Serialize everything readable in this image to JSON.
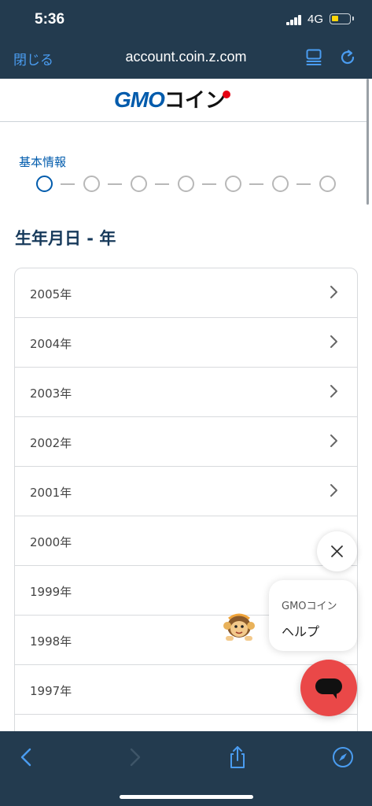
{
  "status": {
    "time": "5:36",
    "network": "4G"
  },
  "browser": {
    "close_label": "閉じる",
    "url": "account.coin.z.com"
  },
  "site": {
    "logo_latin": "GMO",
    "logo_kana": "コイン"
  },
  "progress": {
    "label": "基本情報",
    "total_steps": 7,
    "current_step": 1
  },
  "page": {
    "title": "生年月日 - 年"
  },
  "years": [
    {
      "label": "2005年",
      "has_chevron": true
    },
    {
      "label": "2004年",
      "has_chevron": true
    },
    {
      "label": "2003年",
      "has_chevron": true
    },
    {
      "label": "2002年",
      "has_chevron": true
    },
    {
      "label": "2001年",
      "has_chevron": true
    },
    {
      "label": "2000年",
      "has_chevron": false
    },
    {
      "label": "1999年",
      "has_chevron": false
    },
    {
      "label": "1998年",
      "has_chevron": false
    },
    {
      "label": "1997年",
      "has_chevron": false
    }
  ],
  "help": {
    "line1": "GMOコイン",
    "line2": "ヘルプ"
  },
  "colors": {
    "bar": "#233b4f",
    "accent": "#005bac",
    "link": "#4a9cf0",
    "chat": "#ea4848",
    "logo_red": "#e60012"
  },
  "icons": {
    "reader": "reader-mode-icon",
    "reload": "reload-icon",
    "back": "back-arrow-icon",
    "forward": "forward-arrow-icon",
    "share": "share-icon",
    "safari": "compass-icon",
    "chat": "chat-bubble-icon",
    "close": "close-icon",
    "chevron": "chevron-right-icon"
  }
}
